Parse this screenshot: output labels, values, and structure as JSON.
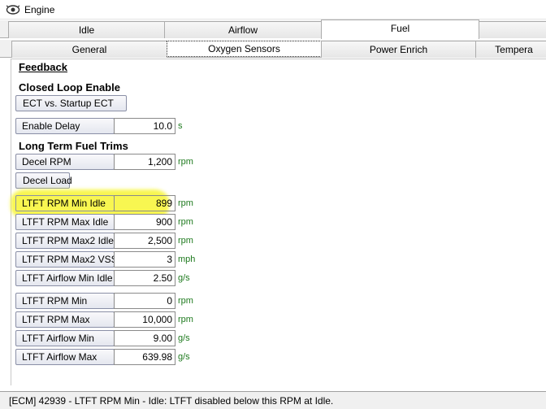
{
  "window": {
    "title": "Engine",
    "icon": "engine-eye-icon"
  },
  "main_tabs": [
    {
      "label": "Idle"
    },
    {
      "label": "Airflow"
    },
    {
      "label": "Fuel",
      "active": true
    },
    {
      "label": ""
    }
  ],
  "sub_tabs": [
    {
      "label": "General"
    },
    {
      "label": "Oxygen Sensors",
      "active": true
    },
    {
      "label": "Power Enrich"
    },
    {
      "label": "Tempera"
    }
  ],
  "feedback": {
    "link": "Feedback",
    "closed_loop_heading": "Closed Loop Enable",
    "ect_button": "ECT vs. Startup ECT",
    "enable_delay": {
      "label": "Enable Delay",
      "value": "10.0",
      "unit": "s"
    },
    "ltft_heading": "Long Term Fuel Trims",
    "decel_rpm": {
      "label": "Decel RPM",
      "value": "1,200",
      "unit": "rpm"
    },
    "decel_load_button": "Decel Load",
    "params": [
      {
        "label": "LTFT RPM Min Idle",
        "value": "899",
        "unit": "rpm",
        "highlighted": true
      },
      {
        "label": "LTFT RPM Max Idle",
        "value": "900",
        "unit": "rpm"
      },
      {
        "label": "LTFT RPM Max2 Idle",
        "value": "2,500",
        "unit": "rpm"
      },
      {
        "label": "LTFT RPM Max2 VSS",
        "value": "3",
        "unit": "mph"
      },
      {
        "label": "LTFT Airflow Min Idle",
        "value": "2.50",
        "unit": "g/s"
      },
      {
        "label": "LTFT RPM Min",
        "value": "0",
        "unit": "rpm"
      },
      {
        "label": "LTFT RPM Max",
        "value": "10,000",
        "unit": "rpm"
      },
      {
        "label": "LTFT Airflow Min",
        "value": "9.00",
        "unit": "g/s"
      },
      {
        "label": "LTFT Airflow Max",
        "value": "639.98",
        "unit": "g/s"
      }
    ]
  },
  "status": {
    "text": "[ECM] 42939 - LTFT RPM Min - Idle: LTFT disabled below this RPM at Idle."
  },
  "colors": {
    "unit_text": "#1e7a1e",
    "highlight": "#f7f532"
  }
}
